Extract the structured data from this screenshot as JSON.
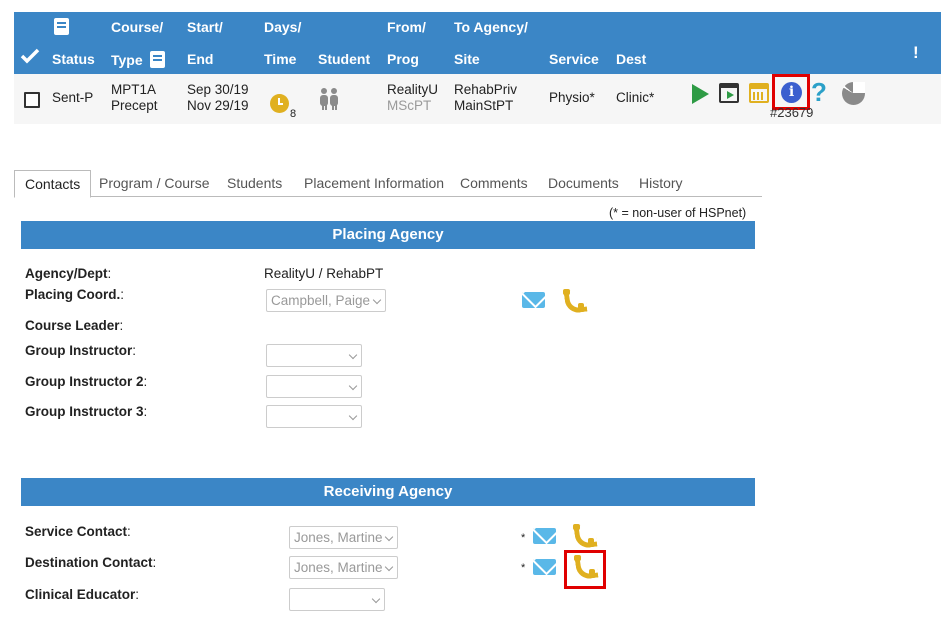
{
  "header": {
    "status": "Status",
    "course_line1": "Course/",
    "course_line2": "Type",
    "start_line1": "Start/",
    "start_line2": "End",
    "days_line1": "Days/",
    "days_line2": "Time",
    "student": "Student",
    "from_line1": "From/",
    "from_line2": "Prog",
    "to_line1": "To Agency/",
    "to_line2": "Site",
    "service": "Service",
    "dest": "Dest",
    "alert": "!"
  },
  "placement": {
    "status": "Sent-P",
    "course": "MPT1A",
    "type": "Precept",
    "start": "Sep 30/19",
    "end": "Nov 29/19",
    "days": "8",
    "from": "RealityU",
    "prog": "MScPT",
    "to_agency": "RehabPriv",
    "site": "MainStPT",
    "service": "Physio*",
    "dest": "Clinic*",
    "ref": "#23679"
  },
  "tabs": [
    {
      "label": "Contacts"
    },
    {
      "label": "Program / Course"
    },
    {
      "label": "Students"
    },
    {
      "label": "Placement Information"
    },
    {
      "label": "Comments"
    },
    {
      "label": "Documents"
    },
    {
      "label": "History"
    }
  ],
  "note": "(* = non-user of HSPnet)",
  "placing": {
    "title": "Placing Agency",
    "agency_label": "Agency/Dept",
    "agency_value": "RealityU / RehabPT",
    "coord_label": "Placing Coord.",
    "coord_value": "Campbell, Paige",
    "leader_label": "Course Leader",
    "gi_label": "Group Instructor",
    "gi2_label": "Group Instructor 2",
    "gi3_label": "Group Instructor 3"
  },
  "receiving": {
    "title": "Receiving Agency",
    "service_label": "Service Contact",
    "service_value": "Jones, Martine",
    "dest_label": "Destination Contact",
    "dest_value": "Jones, Martine",
    "educator_label": "Clinical Educator",
    "star": "*"
  },
  "icons": {
    "info": "i",
    "help": "?"
  },
  "colors": {
    "header_blue": "#3b86c6",
    "highlight_red": "#e00000",
    "play_green": "#2e9b45",
    "phone_gold": "#e0b020",
    "mail_blue": "#5ab8e8"
  }
}
